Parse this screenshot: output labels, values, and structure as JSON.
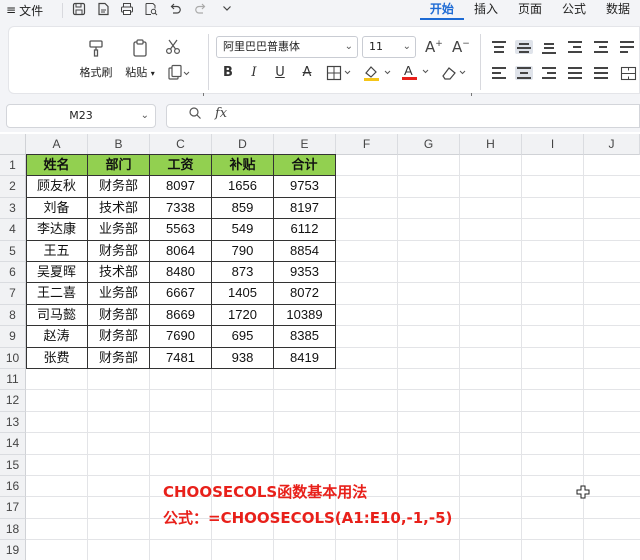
{
  "menu": {
    "file_label": "文件"
  },
  "ribbon_tabs": [
    {
      "label": "开始",
      "active": true
    },
    {
      "label": "插入",
      "active": false
    },
    {
      "label": "页面",
      "active": false
    },
    {
      "label": "公式",
      "active": false
    },
    {
      "label": "数据",
      "active": false
    }
  ],
  "ribbon": {
    "format_painter_label": "格式刷",
    "paste_label": "粘贴",
    "font_name": "阿里巴巴普惠体",
    "font_size": "11",
    "font_color_accent": "#e8201a",
    "fill_color_accent": "#f5c518"
  },
  "formula_bar": {
    "name_box": "M23",
    "fx_label": "fx",
    "content": ""
  },
  "sheet": {
    "columns": [
      "A",
      "B",
      "C",
      "D",
      "E",
      "F",
      "G",
      "H",
      "I",
      "J"
    ],
    "rows": [
      "1",
      "2",
      "3",
      "4",
      "5",
      "6",
      "7",
      "8",
      "9",
      "10",
      "11",
      "12",
      "13",
      "14",
      "15",
      "16",
      "17",
      "18",
      "19"
    ],
    "header_fill": "#92d050",
    "table": {
      "headers": [
        "姓名",
        "部门",
        "工资",
        "补贴",
        "合计"
      ],
      "rows": [
        [
          "顾友秋",
          "财务部",
          "8097",
          "1656",
          "9753"
        ],
        [
          "刘备",
          "技术部",
          "7338",
          "859",
          "8197"
        ],
        [
          "李达康",
          "业务部",
          "5563",
          "549",
          "6112"
        ],
        [
          "王五",
          "财务部",
          "8064",
          "790",
          "8854"
        ],
        [
          "吴夏晖",
          "技术部",
          "8480",
          "873",
          "9353"
        ],
        [
          "王二喜",
          "业务部",
          "6667",
          "1405",
          "8072"
        ],
        [
          "司马懿",
          "财务部",
          "8669",
          "1720",
          "10389"
        ],
        [
          "赵涛",
          "财务部",
          "7690",
          "695",
          "8385"
        ],
        [
          "张费",
          "财务部",
          "7481",
          "938",
          "8419"
        ]
      ]
    },
    "note_title": "CHOOSECOLS函数基本用法",
    "note_formula": "公式：=CHOOSECOLS(A1:E10,-1,-5)",
    "note_color": "#e8201a"
  }
}
